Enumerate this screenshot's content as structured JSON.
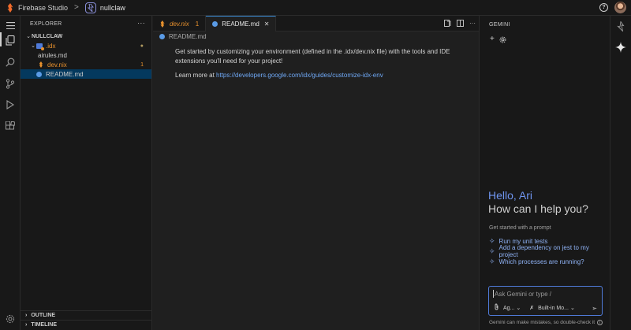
{
  "topbar": {
    "brand": "Firebase Studio",
    "separator": ">",
    "project": "nullclaw",
    "help_icon": "help-icon"
  },
  "activity_bar": {
    "icons": [
      "hamburger-menu-icon",
      "explorer-icon",
      "search-icon",
      "source-control-icon",
      "run-debug-icon",
      "extensions-icon",
      "settings-gear-icon"
    ]
  },
  "sidebar": {
    "title": "EXPLORER",
    "more": "···",
    "root": "NULLCLAW",
    "items": [
      {
        "label": ".idx",
        "badge": "●"
      },
      {
        "label": "airules.md"
      },
      {
        "label": "dev.nix",
        "badge": "1"
      },
      {
        "label": "README.md"
      }
    ],
    "outline": "OUTLINE",
    "timeline": "TIMELINE"
  },
  "editor": {
    "tabs": [
      {
        "label": "dev.nix",
        "badge": "1"
      },
      {
        "label": "README.md",
        "close": "✕"
      }
    ],
    "breadcrumb": "README.md",
    "paragraph1": "Get started by customizing your environment (defined in the .idx/dev.nix file) with the tools and IDE extensions you'll need for your project!",
    "learn_prefix": "Learn more at ",
    "learn_link": "https://developers.google.com/idx/guides/customize-idx-env"
  },
  "gemini": {
    "title": "GEMINI",
    "greeting": "Hello, Ari",
    "question": "How can I help you?",
    "started_label": "Get started with a prompt",
    "prompts": [
      "Run my unit tests",
      "Add a dependency on jest to my project",
      "Which processes are running?"
    ],
    "input_placeholder": "Ask Gemini or type /",
    "agent_label": "Ag...",
    "model_label": "Built-in Mo...",
    "disclaimer": "Gemini can make mistakes, so double-check it",
    "accent": "#6f95f0"
  }
}
